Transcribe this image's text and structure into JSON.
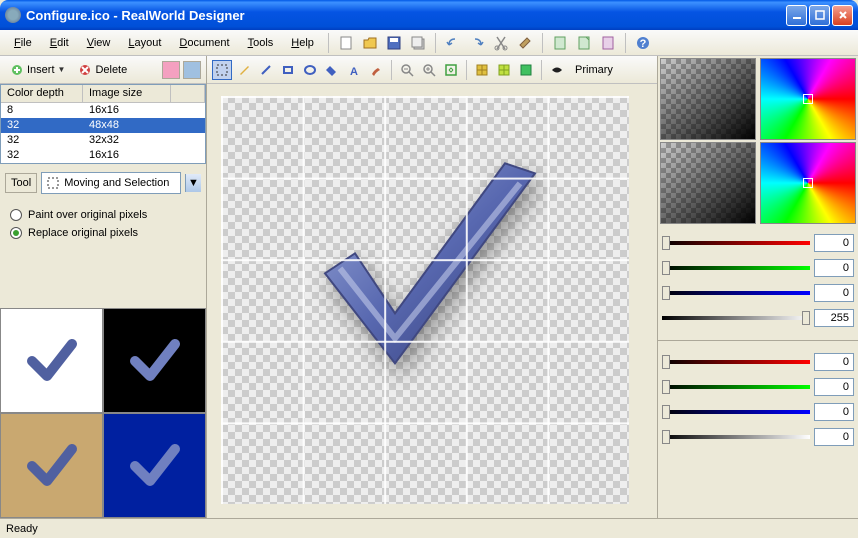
{
  "title": "Configure.ico - RealWorld Designer",
  "menu": {
    "file": "File",
    "edit": "Edit",
    "view": "View",
    "layout": "Layout",
    "document": "Document",
    "tools": "Tools",
    "help": "Help"
  },
  "left": {
    "insert": "Insert",
    "delete": "Delete",
    "table": {
      "headers": {
        "depth": "Color depth",
        "size": "Image size"
      },
      "rows": [
        {
          "depth": "8",
          "size": "16x16"
        },
        {
          "depth": "32",
          "size": "48x48"
        },
        {
          "depth": "32",
          "size": "32x32"
        },
        {
          "depth": "32",
          "size": "16x16"
        }
      ],
      "selected": 1
    },
    "tool_label": "Tool",
    "tool_value": "Moving and Selection",
    "radio": {
      "paint": "Paint over original pixels",
      "replace": "Replace original pixels"
    }
  },
  "canvas": {
    "primary": "Primary"
  },
  "sliders": {
    "set1": {
      "r": "0",
      "g": "0",
      "b": "0",
      "a": "255"
    },
    "set2": {
      "r": "0",
      "g": "0",
      "b": "0",
      "a": "0"
    }
  },
  "status": "Ready"
}
